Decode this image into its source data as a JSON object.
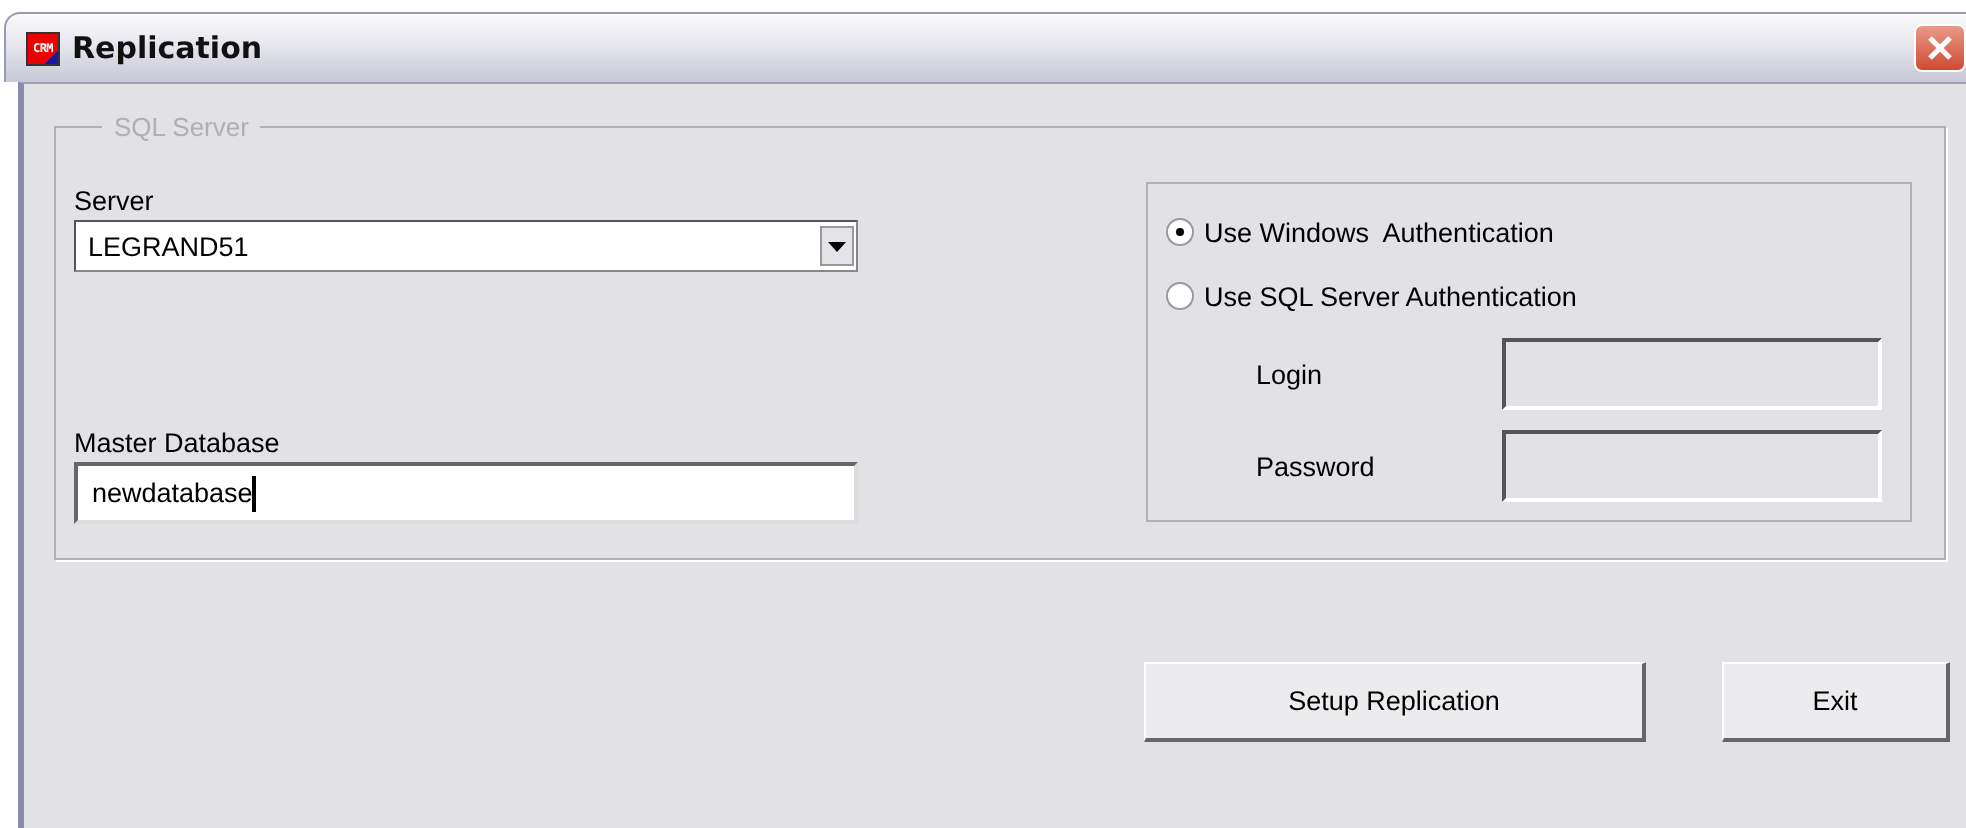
{
  "window": {
    "title": "Replication",
    "icon_label": "CRM"
  },
  "group": {
    "legend": "SQL Server"
  },
  "server": {
    "label": "Server",
    "value": "LEGRAND51"
  },
  "master_database": {
    "label": "Master Database",
    "value": "newdatabase",
    "focused": true
  },
  "auth_options": [
    {
      "label": "Use Windows  Authentication",
      "selected": true
    },
    {
      "label": "Use SQL Server Authentication",
      "selected": false
    }
  ],
  "credentials": [
    {
      "label": "Login",
      "disabled": true
    },
    {
      "label": "Password",
      "disabled": true
    }
  ],
  "buttons": [
    "Setup Replication",
    "Exit"
  ]
}
